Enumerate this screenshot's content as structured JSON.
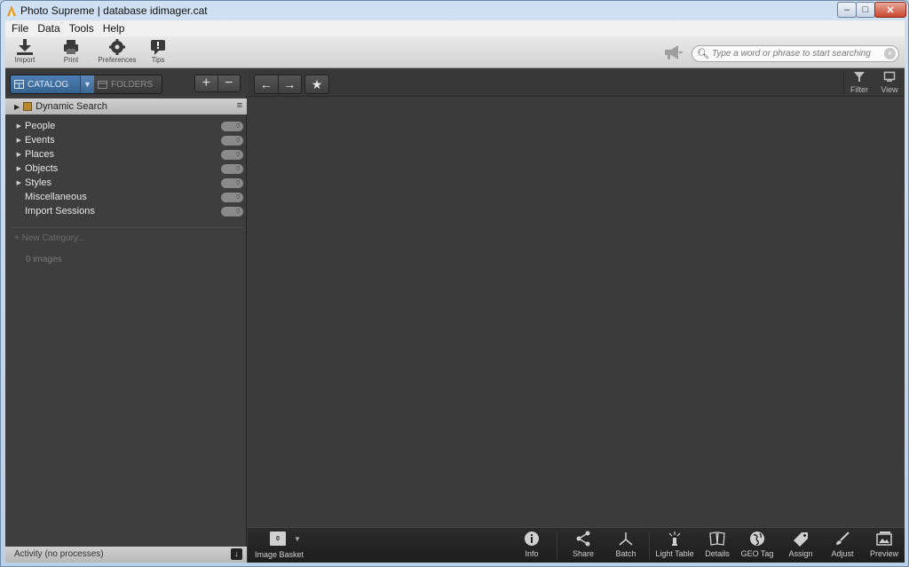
{
  "window": {
    "title": "Photo Supreme | database idimager.cat",
    "minimize": "–",
    "maximize": "□",
    "close": "✕"
  },
  "menu": [
    "File",
    "Data",
    "Tools",
    "Help"
  ],
  "toolbar": {
    "import_label": "Import",
    "print_label": "Print",
    "preferences_label": "Preferences",
    "tips_label": "Tips"
  },
  "search": {
    "placeholder": "Type a word or phrase to start searching",
    "clear": "×"
  },
  "left_panel": {
    "catalog_tab": "CATALOG",
    "folders_tab": "FOLDERS",
    "caret": "▼",
    "add": "+",
    "remove": "−",
    "dynamic_search": "Dynamic Search",
    "dynamic_arrow": "▶",
    "dynamic_menu": "≡",
    "categories": [
      {
        "label": "People",
        "count": "0",
        "arrow": "▶"
      },
      {
        "label": "Events",
        "count": "0",
        "arrow": "▶"
      },
      {
        "label": "Places",
        "count": "0",
        "arrow": "▶"
      },
      {
        "label": "Objects",
        "count": "0",
        "arrow": "▶"
      },
      {
        "label": "Styles",
        "count": "0",
        "arrow": "▶"
      },
      {
        "label": "Miscellaneous",
        "count": "0",
        "arrow": ""
      },
      {
        "label": "Import Sessions",
        "count": "0",
        "arrow": ""
      }
    ],
    "new_category": "+ New Category...",
    "images_count": "0 images",
    "activity": "Activity (no processes)",
    "activity_button": "↓"
  },
  "main": {
    "back": "←",
    "forward": "→",
    "star": "★",
    "filter_label": "Filter",
    "view_label": "View"
  },
  "bottom_bar": {
    "basket_count": "0",
    "basket_caret": "▼",
    "basket_label": "Image Basket",
    "info_label": "Info",
    "share_label": "Share",
    "batch_label": "Batch",
    "light_table_label": "Light Table",
    "details_label": "Details",
    "geo_tag_label": "GEO Tag",
    "assign_label": "Assign",
    "adjust_label": "Adjust",
    "preview_label": "Preview"
  }
}
